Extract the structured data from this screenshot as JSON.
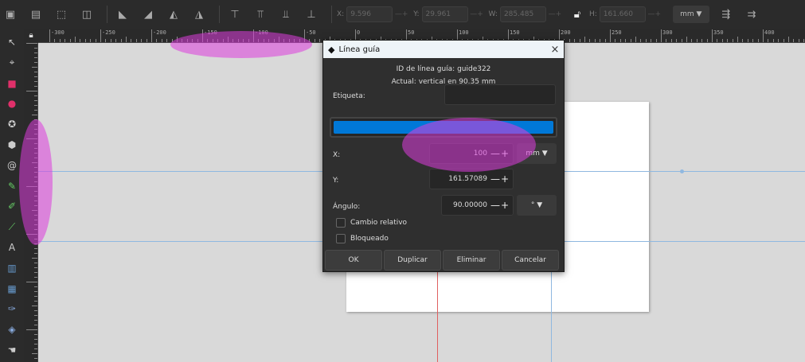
{
  "toolbar": {
    "x_label": "X:",
    "x_value": "9.596",
    "y_label": "Y:",
    "y_value": "29.961",
    "w_label": "W:",
    "w_value": "285.485",
    "h_label": "H:",
    "h_value": "161.660",
    "unit": "mm ▼"
  },
  "ruler": {
    "labels": [
      "-300",
      "-250",
      "-200",
      "-150",
      "-100",
      "-50",
      "0",
      "50",
      "100",
      "150",
      "200",
      "250",
      "300",
      "350",
      "400"
    ]
  },
  "dialog": {
    "title": "Línea guía",
    "close": "×",
    "guide_id": "ID de línea guía: guide322",
    "current": "Actual: vertical en 90.35 mm",
    "label_label": "Etiqueta:",
    "label_value": "",
    "x_label": "X:",
    "x_value": "100",
    "x_unit": "mm ▼",
    "y_label": "Y:",
    "y_value": "161.57089",
    "angle_label": "Ángulo:",
    "angle_value": "90.00000",
    "angle_unit": "° ▼",
    "relative_label": "Cambio relativo",
    "locked_label": "Bloqueado",
    "ok": "OK",
    "duplicate": "Duplicar",
    "delete": "Eliminar",
    "cancel": "Cancelar",
    "pm": "—+"
  },
  "colors": {
    "guide_color": "#0078d7",
    "highlight": "#dc3cdc"
  }
}
